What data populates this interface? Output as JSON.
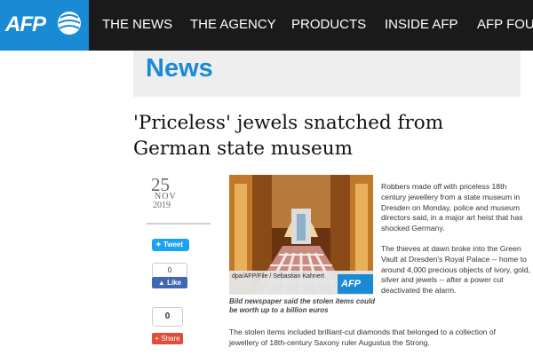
{
  "brand": {
    "logo_text": "AFP",
    "accent_color": "#1a8ad4"
  },
  "nav": {
    "items": [
      "THE NEWS",
      "THE AGENCY",
      "PRODUCTS",
      "INSIDE AFP",
      "AFP FOU"
    ]
  },
  "section": {
    "title": "News"
  },
  "article": {
    "headline_line1": "'Priceless' jewels snatched from",
    "headline_line2": "German state museum",
    "date": {
      "day": "25",
      "month": "NOV",
      "year": "2019"
    },
    "photo": {
      "credit": "dpa/AFP/File / Sebastian Kahnert",
      "badge": "AFP",
      "caption": "Bild newspaper said the stolen items could be worth up to a billion euros"
    },
    "paragraphs": [
      "Robbers made off with priceless 18th century jewellery from a state museum in Dresden on Monday, police and museum directors said, in a major art heist that has shocked Germany.",
      "The thieves at dawn broke into the Green Vault at Dresden's Royal Palace -- home to around 4,000 precious objects of ivory, gold, silver and jewels -- after a power cut deactivated the alarm.",
      "The stolen items included brilliant-cut diamonds that belonged to a collection of jewellery of 18th-century Saxony ruler Augustus the Strong."
    ]
  },
  "share": {
    "tweet_label": "Tweet",
    "like_count": "0",
    "like_label": "Like",
    "share_count": "0",
    "share_label": "Share"
  }
}
